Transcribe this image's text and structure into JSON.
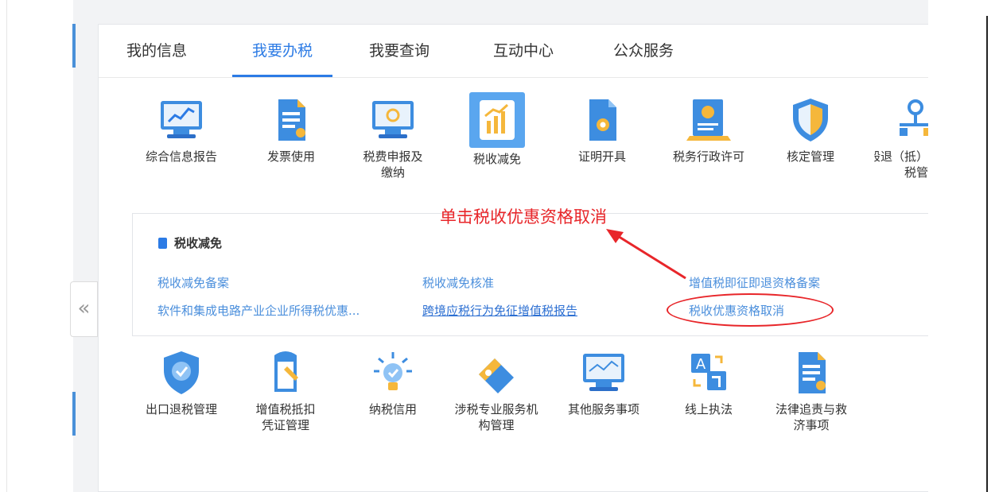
{
  "tabs": [
    "我的信息",
    "我要办税",
    "我要查询",
    "互动中心",
    "公众服务"
  ],
  "top_icons": [
    {
      "label": "综合信息报告",
      "icon": "monitor-chart-icon"
    },
    {
      "label": "发票使用",
      "icon": "invoice-document-icon"
    },
    {
      "label": "税费申报及缴纳",
      "icon": "monitor-coin-icon"
    },
    {
      "label": "税收减免",
      "icon": "chart-growth-icon"
    },
    {
      "label": "证明开具",
      "icon": "certificate-stamp-icon"
    },
    {
      "label": "税务行政许可",
      "icon": "license-award-icon"
    },
    {
      "label": "核定管理",
      "icon": "shield-icon"
    },
    {
      "label": "一般退（抵）税管",
      "icon": "flow-chart-icon"
    }
  ],
  "panel": {
    "title": "税收减免",
    "links": [
      "税收减免备案",
      "税收减免核准",
      "增值税即征即退资格备案",
      "软件和集成电路产业企业所得税优惠...",
      "跨境应税行为免征增值税报告",
      "税收优惠资格取消"
    ]
  },
  "bottom_icons": [
    {
      "label": "出口退税管理",
      "icon": "shield-check-icon"
    },
    {
      "label": "增值税抵扣凭证管理",
      "icon": "document-edit-icon"
    },
    {
      "label": "纳税信用",
      "icon": "lightbulb-check-icon"
    },
    {
      "label": "涉税专业服务机构管理",
      "icon": "tag-star-icon"
    },
    {
      "label": "其他服务事项",
      "icon": "monitor-wave-icon"
    },
    {
      "label": "线上执法",
      "icon": "translate-icon"
    },
    {
      "label": "法律追责与救济事项",
      "icon": "legal-document-icon"
    }
  ],
  "annotation": "单击税收优惠资格取消",
  "collapse_glyph": "«",
  "colors": {
    "accent": "#2c7be5",
    "annotation": "#e8262a",
    "link": "#4b8fdc"
  }
}
